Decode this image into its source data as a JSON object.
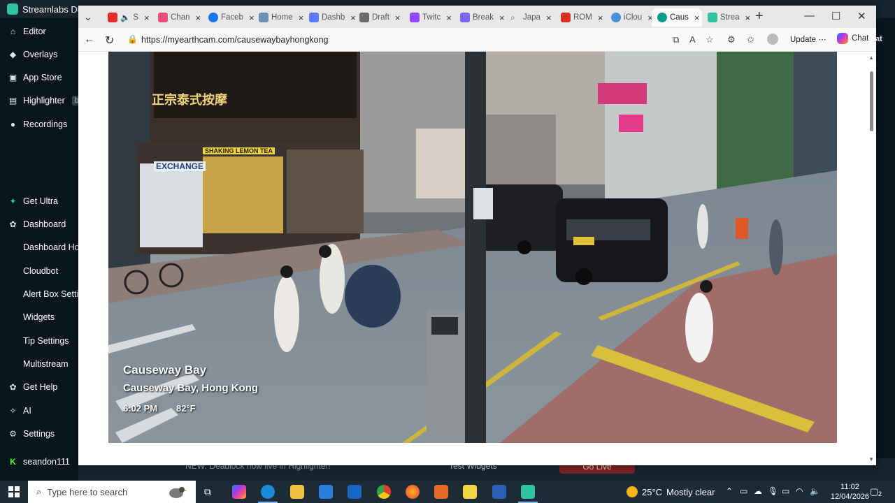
{
  "streamlabs": {
    "title": "Streamlabs De",
    "sidebar": [
      {
        "label": "Editor",
        "icon": "home-icon"
      },
      {
        "label": "Overlays",
        "icon": "overlays-icon"
      },
      {
        "label": "App Store",
        "icon": "store-icon"
      },
      {
        "label": "Highlighter",
        "icon": "highlighter-icon",
        "badge": "be"
      },
      {
        "label": "Recordings",
        "icon": "recordings-icon"
      },
      {
        "label": "Get Ultra",
        "icon": "ultra-icon"
      },
      {
        "label": "Dashboard",
        "icon": "dashboard-icon"
      },
      {
        "label": "Dashboard Hor",
        "icon": ""
      },
      {
        "label": "Cloudbot",
        "icon": ""
      },
      {
        "label": "Alert Box Settin",
        "icon": ""
      },
      {
        "label": "Widgets",
        "icon": ""
      },
      {
        "label": "Tip Settings",
        "icon": ""
      },
      {
        "label": "Multistream",
        "icon": ""
      },
      {
        "label": "Get Help",
        "icon": "help-icon"
      },
      {
        "label": "AI",
        "icon": "ai-icon"
      },
      {
        "label": "Settings",
        "icon": "settings-icon"
      },
      {
        "label": "seandon111",
        "icon": "kick-icon"
      }
    ],
    "right_peek": "at",
    "bottom_text": "NEW: Deadlock now live in Highlighter!",
    "bottom_text2": "Test Widgets",
    "go_live": "Go Live"
  },
  "browser": {
    "tabs": [
      {
        "label": "S",
        "color": "#e52d27"
      },
      {
        "label": "Chan",
        "color": "#e84e7a"
      },
      {
        "label": "Faceb",
        "color": "#1877f2"
      },
      {
        "label": "Home",
        "color": "#6b8fb5"
      },
      {
        "label": "Dashb",
        "color": "#5c7cfa"
      },
      {
        "label": "Draft",
        "color": "#6b6b6b"
      },
      {
        "label": "Twitc",
        "color": "#9146ff"
      },
      {
        "label": "Break",
        "color": "#7b68ee"
      },
      {
        "label": "Japa",
        "color": "#777777"
      },
      {
        "label": "ROM",
        "color": "#d93025"
      },
      {
        "label": "iClou",
        "color": "#4a90d9"
      },
      {
        "label": "Caus",
        "color": "#0f9d8a",
        "active": true
      },
      {
        "label": "Strea",
        "color": "#31c3a2"
      }
    ],
    "url": "https://myearthcam.com/causewaybayhongkong",
    "update_label": "Update",
    "chat_label": "Chat"
  },
  "webcam": {
    "title": "Causeway Bay",
    "location": "Causeway Bay, Hong Kong",
    "time": "6:02 PM",
    "temperature": "82°F",
    "signs": {
      "massage": "正宗泰式按摩",
      "exchange": "EXCHANGE",
      "lemon_tea": "SHAKING LEMON TEA"
    }
  },
  "taskbar": {
    "search_placeholder": "Type here to search",
    "weather_temp": "25°C",
    "weather_desc": "Mostly clear",
    "time": "11:02",
    "date": "12/04/2026",
    "notifications": "2"
  }
}
